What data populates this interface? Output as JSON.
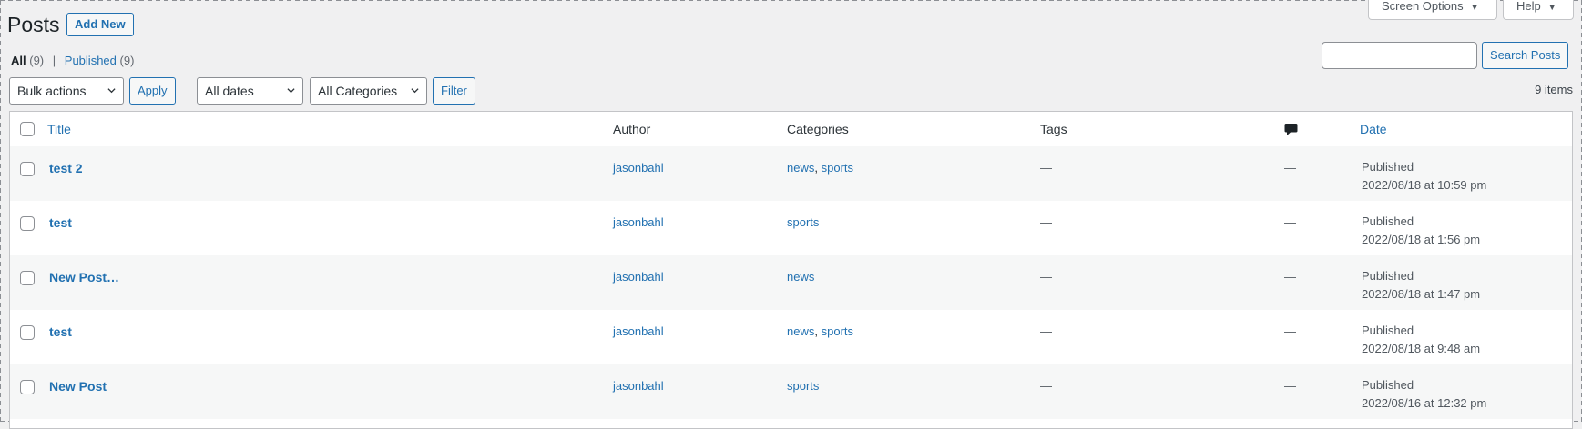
{
  "header": {
    "title": "Posts",
    "add_new": "Add New",
    "screen_options": "Screen Options",
    "help": "Help"
  },
  "views": {
    "all_label": "All",
    "all_count": "(9)",
    "separator": "|",
    "published_label": "Published",
    "published_count": "(9)"
  },
  "search": {
    "value": "",
    "button": "Search Posts"
  },
  "tablenav": {
    "bulk_actions": "Bulk actions",
    "apply": "Apply",
    "dates": "All dates",
    "categories": "All Categories",
    "filter": "Filter",
    "items_count": "9 items"
  },
  "columns": {
    "title": "Title",
    "author": "Author",
    "categories": "Categories",
    "tags": "Tags",
    "comments_icon": "comment-bubble-icon",
    "date": "Date"
  },
  "rows": [
    {
      "title": "test 2",
      "author": "jasonbahl",
      "cat1": "news",
      "cat_sep": ",",
      "cat2": "sports",
      "tags": "—",
      "comments": "—",
      "status": "Published",
      "date": "2022/08/18 at 10:59 pm"
    },
    {
      "title": "test",
      "author": "jasonbahl",
      "cat1": "sports",
      "cat_sep": "",
      "cat2": "",
      "tags": "—",
      "comments": "—",
      "status": "Published",
      "date": "2022/08/18 at 1:56 pm"
    },
    {
      "title": "New Post…",
      "author": "jasonbahl",
      "cat1": "news",
      "cat_sep": "",
      "cat2": "",
      "tags": "—",
      "comments": "—",
      "status": "Published",
      "date": "2022/08/18 at 1:47 pm"
    },
    {
      "title": "test",
      "author": "jasonbahl",
      "cat1": "news",
      "cat_sep": ",",
      "cat2": "sports",
      "tags": "—",
      "comments": "—",
      "status": "Published",
      "date": "2022/08/18 at 9:48 am"
    },
    {
      "title": "New Post",
      "author": "jasonbahl",
      "cat1": "sports",
      "cat_sep": "",
      "cat2": "",
      "tags": "—",
      "comments": "—",
      "status": "Published",
      "date": "2022/08/16 at 12:32 pm"
    }
  ],
  "colors": {
    "link": "#2271b1",
    "background": "#f0f0f1",
    "border": "#c3c4c7"
  }
}
